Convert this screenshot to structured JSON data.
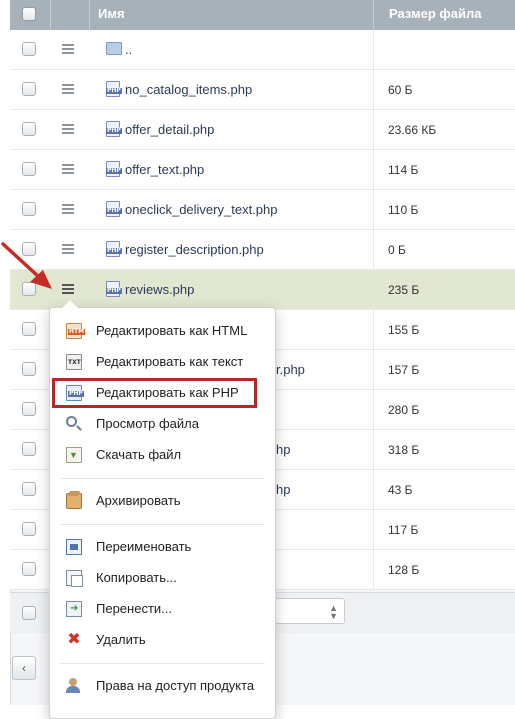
{
  "header": {
    "name_col": "Имя",
    "size_col": "Размер файла"
  },
  "rows": [
    {
      "name": "..",
      "size": "",
      "type": "folder-up"
    },
    {
      "name": "no_catalog_items.php",
      "size": "60 Б",
      "type": "php"
    },
    {
      "name": "offer_detail.php",
      "size": "23.66 КБ",
      "type": "php"
    },
    {
      "name": "offer_text.php",
      "size": "114 Б",
      "type": "php"
    },
    {
      "name": "oneclick_delivery_text.php",
      "size": "110 Б",
      "type": "php"
    },
    {
      "name": "register_description.php",
      "size": "0 Б",
      "type": "php"
    },
    {
      "name": "reviews.php",
      "size": "235 Б",
      "type": "php",
      "highlighted": true
    },
    {
      "name": "",
      "size": "155 Б",
      "type": "php"
    },
    {
      "name": "r.php",
      "size": "157 Б",
      "type": "php"
    },
    {
      "name": "",
      "size": "280 Б",
      "type": "php"
    },
    {
      "name": "hp",
      "size": "318 Б",
      "type": "php"
    },
    {
      "name": "hp",
      "size": "43 Б",
      "type": "php"
    },
    {
      "name": "",
      "size": "117 Б",
      "type": "php"
    },
    {
      "name": "",
      "size": "128 Б",
      "type": "php"
    }
  ],
  "pager": {
    "prev": "‹"
  },
  "context_menu": {
    "items": [
      {
        "label": "Редактировать как HTML",
        "icon": "html-file-icon",
        "badge": "HTM"
      },
      {
        "label": "Редактировать как текст",
        "icon": "text-file-icon",
        "badge": "TXT"
      },
      {
        "label": "Редактировать как PHP",
        "icon": "php-file-icon",
        "badge": "PHP",
        "highlighted": true
      },
      {
        "label": "Просмотр файла",
        "icon": "view-icon"
      },
      {
        "label": "Скачать файл",
        "icon": "download-icon"
      },
      {
        "label": "Архивировать",
        "icon": "archive-icon"
      },
      {
        "label": "Переименовать",
        "icon": "rename-icon"
      },
      {
        "label": "Копировать...",
        "icon": "copy-icon"
      },
      {
        "label": "Перенести...",
        "icon": "move-icon"
      },
      {
        "label": "Удалить",
        "icon": "delete-icon"
      },
      {
        "label": "Права на доступ продукта",
        "icon": "access-rights-icon"
      }
    ]
  },
  "colors": {
    "header_bg": "#a6b1ba",
    "highlight_row": "#e1e7d1",
    "callout_border": "#b02a2a",
    "arrow": "#c62c26"
  }
}
